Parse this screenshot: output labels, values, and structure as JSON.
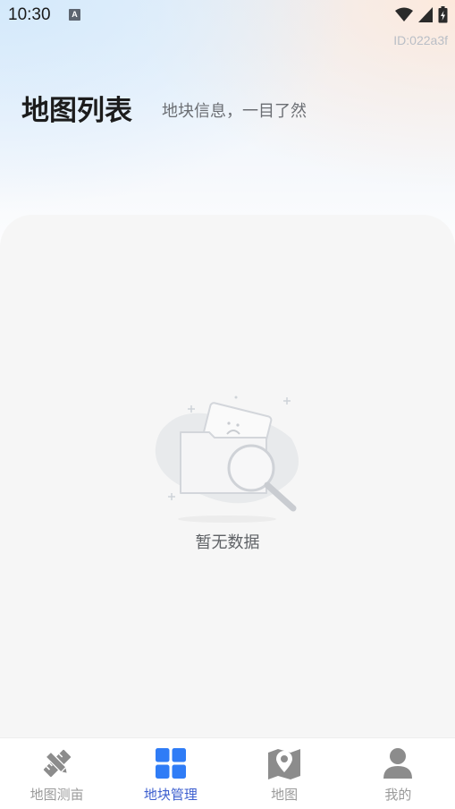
{
  "status_bar": {
    "time": "10:30",
    "notification_icon": "font-a-icon",
    "icons": [
      "wifi-icon",
      "signal-icon",
      "battery-charging-icon"
    ]
  },
  "device_id": "ID:022a3f",
  "header": {
    "title": "地图列表",
    "subtitle": "地块信息，一目了然"
  },
  "empty_state": {
    "icon": "empty-folder-search-icon",
    "text": "暂无数据"
  },
  "tabbar": {
    "active_color": "#2f7cf6",
    "inactive_color": "#9a9a9a",
    "items": [
      {
        "label": "地图测亩",
        "icon": "ruler-pencil-icon",
        "active": false
      },
      {
        "label": "地块管理",
        "icon": "grid-icon",
        "active": true
      },
      {
        "label": "地图",
        "icon": "map-pin-icon",
        "active": false
      },
      {
        "label": "我的",
        "icon": "user-icon",
        "active": false
      }
    ]
  }
}
